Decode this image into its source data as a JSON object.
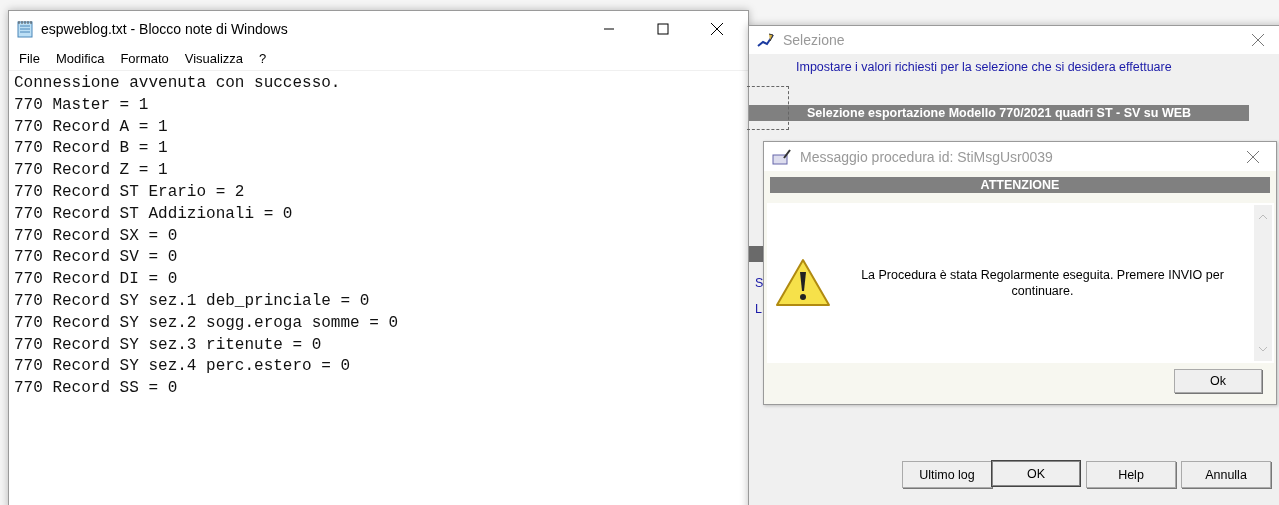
{
  "notepad": {
    "title": "espweblog.txt - Blocco note di Windows",
    "menu": [
      "File",
      "Modifica",
      "Formato",
      "Visualizza",
      "?"
    ],
    "lines": [
      "Connessione avvenuta con successo.",
      "770 Master = 1",
      "770 Record A = 1",
      "770 Record B = 1",
      "770 Record Z = 1",
      "770 Record ST Erario = 2",
      "770 Record ST Addizionali = 0",
      "770 Record SX = 0",
      "770 Record SV = 0",
      "770 Record DI = 0",
      "770 Record SY sez.1 deb_princiale = 0",
      "770 Record SY sez.2 sogg.eroga somme = 0",
      "770 Record SY sez.3 ritenute = 0",
      "770 Record SY sez.4 perc.estero = 0",
      "770 Record SS = 0"
    ]
  },
  "selection_window": {
    "title": "Selezione",
    "instruction": "Impostare i valori richiesti per la selezione che si desidera effettuare",
    "section_header": "Selezione esportazione Modello 770/2021 quadri ST - SV su WEB",
    "partial_links": [
      "S",
      "L"
    ],
    "buttons": [
      {
        "label": "Ultimo log",
        "default": false
      },
      {
        "label": "OK",
        "default": true
      },
      {
        "label": "Help",
        "default": false
      },
      {
        "label": "Annulla",
        "default": false
      }
    ]
  },
  "message_dialog": {
    "title": "Messaggio procedura id: StiMsgUsr0039",
    "header": "ATTENZIONE",
    "message": "La Procedura è stata Regolarmente eseguita. Premere INVIO per continuare.",
    "button": "Ok"
  }
}
